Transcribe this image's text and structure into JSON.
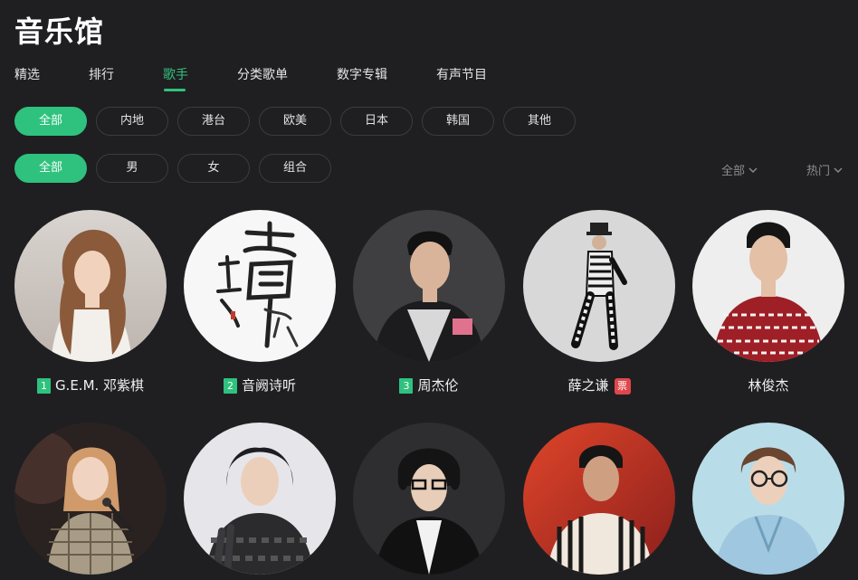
{
  "page": {
    "title": "音乐馆"
  },
  "tabs": [
    {
      "label": "精选"
    },
    {
      "label": "排行"
    },
    {
      "label": "歌手",
      "active": true
    },
    {
      "label": "分类歌单"
    },
    {
      "label": "数字专辑"
    },
    {
      "label": "有声节目"
    }
  ],
  "filters": {
    "region": [
      {
        "label": "全部",
        "active": true
      },
      {
        "label": "内地"
      },
      {
        "label": "港台"
      },
      {
        "label": "欧美"
      },
      {
        "label": "日本"
      },
      {
        "label": "韩国"
      },
      {
        "label": "其他"
      }
    ],
    "gender": [
      {
        "label": "全部",
        "active": true
      },
      {
        "label": "男"
      },
      {
        "label": "女"
      },
      {
        "label": "组合"
      }
    ]
  },
  "sort": {
    "scope_label": "全部",
    "order_label": "热门"
  },
  "colors": {
    "accent": "#31c27c",
    "background": "#1f1f22",
    "badge_red": "#e0474c"
  },
  "singers": [
    {
      "rank": "1",
      "name": "G.E.M. 邓紫棋"
    },
    {
      "rank": "2",
      "name": "音阙诗听"
    },
    {
      "rank": "3",
      "name": "周杰伦"
    },
    {
      "name": "薛之谦",
      "badge": "票"
    },
    {
      "name": "林俊杰"
    },
    {
      "name": ""
    },
    {
      "name": ""
    },
    {
      "name": ""
    },
    {
      "name": ""
    },
    {
      "name": ""
    }
  ]
}
